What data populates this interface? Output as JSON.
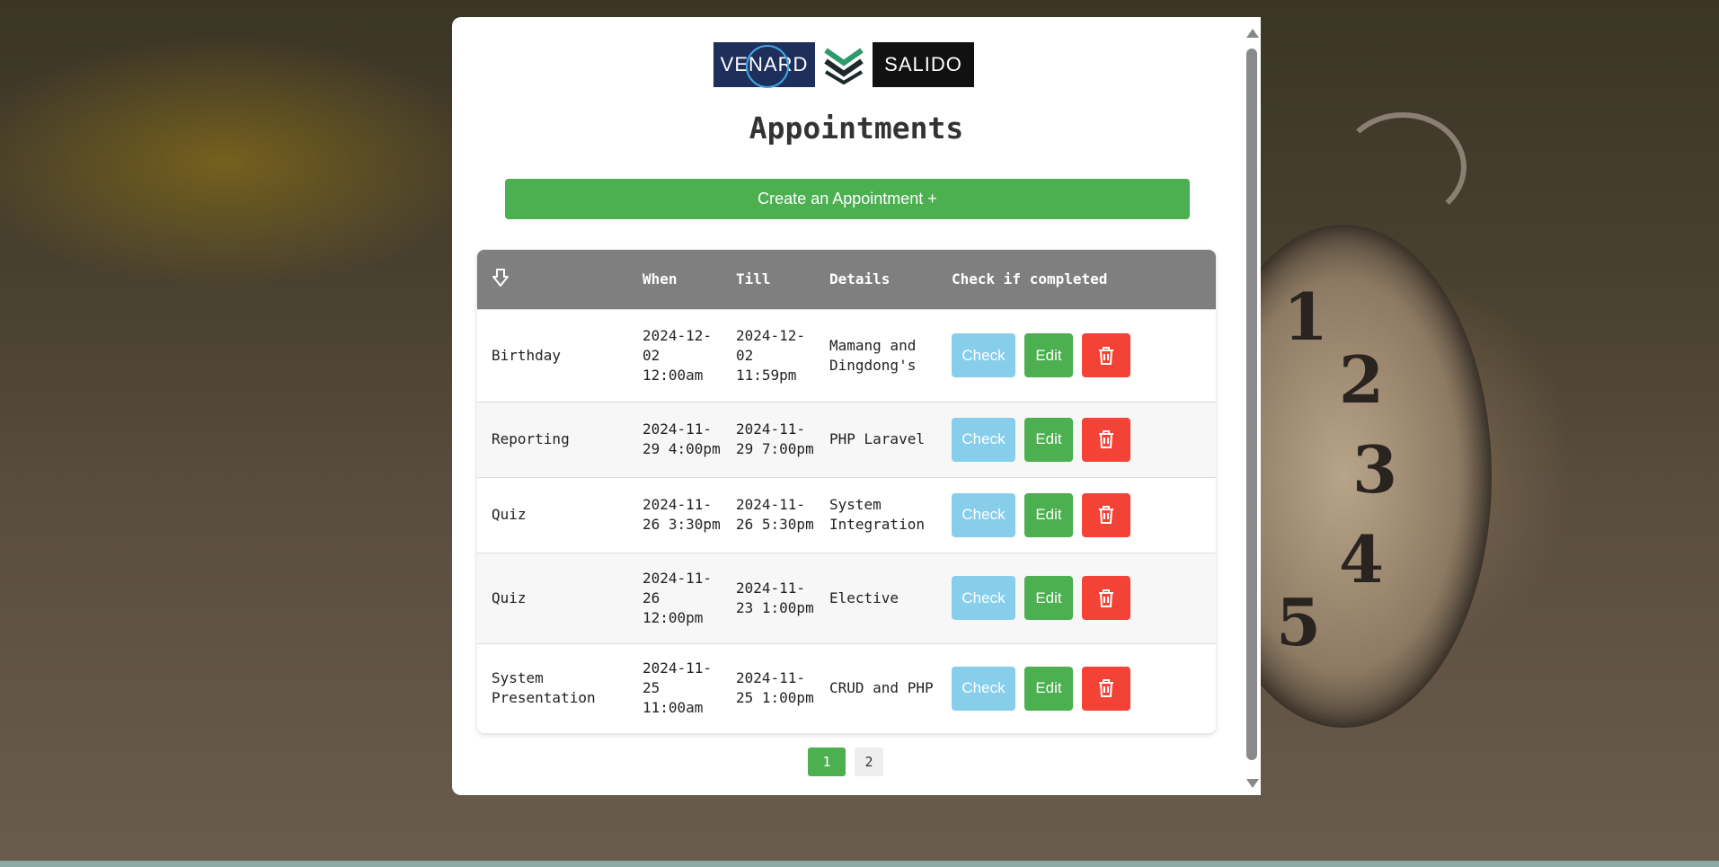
{
  "logos": {
    "left": "VENARD",
    "right": "SALIDO"
  },
  "page_title": "Appointments",
  "create_button": "Create an Appointment +",
  "table": {
    "headers": [
      "",
      "When",
      "Till",
      "Details",
      "Check if completed"
    ],
    "rows": [
      {
        "title": "Birthday",
        "when": "2024-12-02 12:00am",
        "till": "2024-12-02 11:59pm",
        "details": "Mamang and Dingdong's"
      },
      {
        "title": "Reporting",
        "when": "2024-11-29 4:00pm",
        "till": "2024-11-29 7:00pm",
        "details": "PHP Laravel"
      },
      {
        "title": "Quiz",
        "when": "2024-11-26 3:30pm",
        "till": "2024-11-26 5:30pm",
        "details": "System Integration"
      },
      {
        "title": "Quiz",
        "when": "2024-11-26 12:00pm",
        "till": "2024-11-23 1:00pm",
        "details": "Elective"
      },
      {
        "title": "System Presentation",
        "when": "2024-11-25 11:00am",
        "till": "2024-11-25 1:00pm",
        "details": "CRUD and PHP"
      }
    ],
    "actions": {
      "check": "Check",
      "edit": "Edit",
      "delete_icon": "trash-icon"
    }
  },
  "pagination": {
    "pages": [
      "1",
      "2"
    ],
    "current": "1"
  },
  "background": {
    "clock_numbers": [
      "1",
      "2",
      "3",
      "4",
      "5"
    ]
  },
  "colors": {
    "primary": "#4caf50",
    "check": "#87ceeb",
    "delete": "#f44336",
    "header": "#7f7f7f"
  }
}
